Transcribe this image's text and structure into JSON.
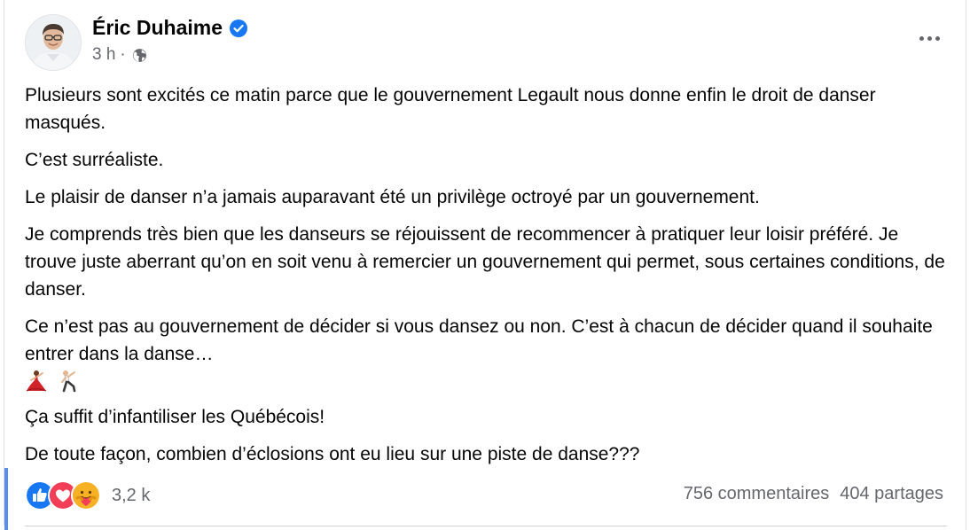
{
  "post": {
    "author": "Éric Duhaime",
    "verified_icon": "verified-badge-icon",
    "time": "3 h",
    "separator": "·",
    "audience_icon": "globe-icon",
    "more_icon": "more-options-icon",
    "paragraphs": [
      "Plusieurs sont excités ce matin parce que le gouvernement Legault nous donne enfin le droit de danser masqués.",
      "C’est surréaliste.",
      "Le plaisir de danser n’a jamais auparavant été un privilège octroyé par un gouvernement.",
      "Je comprends très bien que les danseurs se réjouissent de recommencer à pratiquer leur loisir préféré. Je trouve juste aberrant qu’on en soit venu à remercier un gouvernement qui permet, sous certaines conditions, de danser.",
      "Ce n’est pas au gouvernement de décider si vous dansez ou non. C’est à chacun de décider quand il souhaite entrer dans la danse…"
    ],
    "emojis": [
      "dancer-woman-emoji",
      "dancer-man-emoji"
    ],
    "paragraphs_after": [
      "Ça suffit d’infantiliser les Québécois!",
      "De toute façon, combien d’éclosions ont eu lieu sur une piste de danse???"
    ]
  },
  "footer": {
    "reactions": [
      "like-reaction-icon",
      "love-reaction-icon",
      "care-reaction-icon"
    ],
    "reaction_count": "3,2 k",
    "comments": "756 commentaires",
    "shares": "404 partages"
  },
  "colors": {
    "like": "#1877f2",
    "love": "#f33e58",
    "care": "#f7b125",
    "accent": "#5b8def",
    "muted_text": "#65676b"
  }
}
